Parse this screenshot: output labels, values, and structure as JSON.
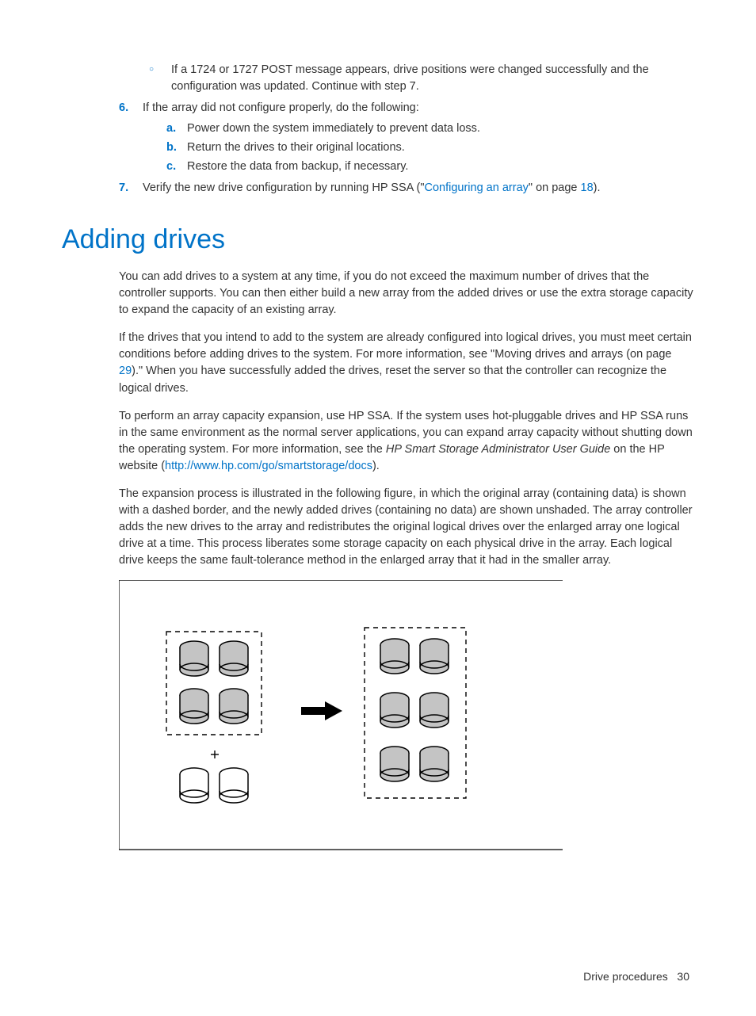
{
  "sub_bullet": "If a 1724 or 1727 POST message appears, drive positions were changed successfully and the configuration was updated. Continue with step 7.",
  "steps": {
    "n6": "6.",
    "s6": "If the array did not configure properly, do the following:",
    "a_m": "a.",
    "a_t": "Power down the system immediately to prevent data loss.",
    "b_m": "b.",
    "b_t": "Return the drives to their original locations.",
    "c_m": "c.",
    "c_t": "Restore the data from backup, if necessary.",
    "n7": "7.",
    "s7_a": "Verify the new drive configuration by running HP SSA (\"",
    "s7_link": "Configuring an array",
    "s7_b": "\" on page ",
    "s7_pg": "18",
    "s7_c": ")."
  },
  "heading": "Adding drives",
  "p1": "You can add drives to a system at any time, if you do not exceed the maximum number of drives that the controller supports. You can then either build a new array from the added drives or use the extra storage capacity to expand the capacity of an existing array.",
  "p2_a": "If the drives that you intend to add to the system are already configured into logical drives, you must meet certain conditions before adding drives to the system. For more information, see \"Moving drives and arrays (on page ",
  "p2_pg": "29",
  "p2_b": ").\" When you have successfully added the drives, reset the server so that the controller can recognize the logical drives.",
  "p3_a": "To perform an array capacity expansion, use HP SSA. If the system uses hot-pluggable drives and HP SSA runs in the same environment as the normal server applications, you can expand array capacity without shutting down the operating system. For more information, see the ",
  "p3_i": "HP Smart Storage Administrator User Guide",
  "p3_b": " on the HP website (",
  "p3_link": "http://www.hp.com/go/smartstorage/docs",
  "p3_c": ").",
  "p4": "The expansion process is illustrated in the following figure, in which the original array (containing data) is shown with a dashed border, and the newly added drives (containing no data) are shown unshaded. The array controller adds the new drives to the array and redistributes the original logical drives over the enlarged array one logical drive at a time. This process liberates some storage capacity on each physical drive in the array. Each logical drive keeps the same fault-tolerance method in the enlarged array that it had in the smaller array.",
  "footer_label": "Drive procedures",
  "footer_page": "30"
}
